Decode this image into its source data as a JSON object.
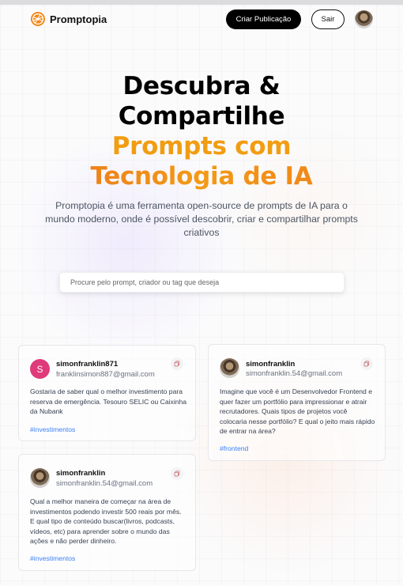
{
  "nav": {
    "brand": "Promptopia",
    "create_label": "Criar Publicação",
    "signout_label": "Sair"
  },
  "hero": {
    "line1": "Descubra &",
    "line2": "Compartilhe",
    "line3": "Prompts com",
    "line4": "Tecnologia de IA",
    "subtitle": "Promptopia é uma ferramenta open-source de prompts de IA para o mundo moderno, onde é possível descobrir, criar e compartilhar prompts criativos"
  },
  "search": {
    "placeholder": "Procure pelo prompt, criador ou tag que deseja",
    "value": ""
  },
  "cards": [
    {
      "avatar_letter": "S",
      "username": "simonfranklin871",
      "email": "franklinsimon887@gmail.com",
      "text": "Gostaria de saber qual o melhor investimento para reserva de emergência. Tesouro SELIC ou Caixinha da Nubank",
      "tag": "#investimentos"
    },
    {
      "username": "simonfranklin",
      "email": "simonfranklin.54@gmail.com",
      "text": "Imagine que você é um Desenvolvedor Frontend e quer fazer um portfólio para impressionar e atrair recrutadores. Quais tipos de projetos você colocaria nesse portfólio? E qual o jeito mais rápido de entrar na área?",
      "tag": "#frontend"
    },
    {
      "username": "simonfranklin",
      "email": "simonfranklin.54@gmail.com",
      "text": "Qual a melhor maneira de começar na área de investimentos podendo investir 500 reais por mês. E qual tipo de conteúdo buscar(livros, podcasts, vídeos, etc) para aprender sobre o mundo das ações e não perder dinheiro.",
      "tag": "#investimentos"
    }
  ],
  "colors": {
    "accent_orange": "#f19d12",
    "accent_orange_deep": "#ea6d1a",
    "tag_blue": "#3b82f6",
    "avatar_pink": "#df3a7a"
  },
  "icons": [
    "logo-icon",
    "copy-icon"
  ]
}
